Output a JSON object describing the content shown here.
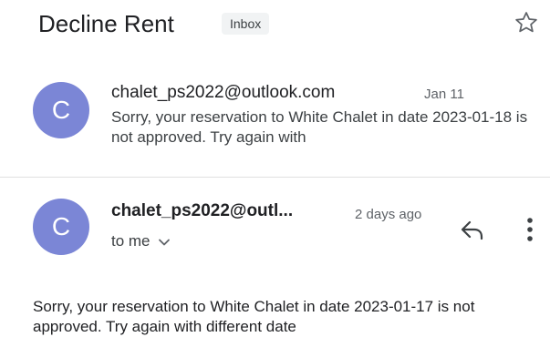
{
  "thread": {
    "subject": "Decline Rent",
    "label": "Inbox",
    "star_icon": "star-outline-icon"
  },
  "messages": [
    {
      "avatar_letter": "C",
      "sender": "chalet_ps2022@outlook.com",
      "date": "Jan 11",
      "snippet": "Sorry, your reservation to White Chalet in date 2023-01-18 is not approved. Try again with"
    },
    {
      "avatar_letter": "C",
      "sender": "chalet_ps2022@outl...",
      "date": "2 days ago",
      "recipient": "to me",
      "body": "Sorry, your reservation to White Chalet in date 2023-01-17 is not approved. Try again with different date"
    }
  ],
  "colors": {
    "avatar": "#7b86d6",
    "text_primary": "#202124",
    "text_secondary": "#5f6368"
  },
  "icons": {
    "star": "star-outline-icon",
    "reply": "reply-arrow-icon",
    "more": "more-vertical-icon",
    "expand": "chevron-down-icon"
  }
}
